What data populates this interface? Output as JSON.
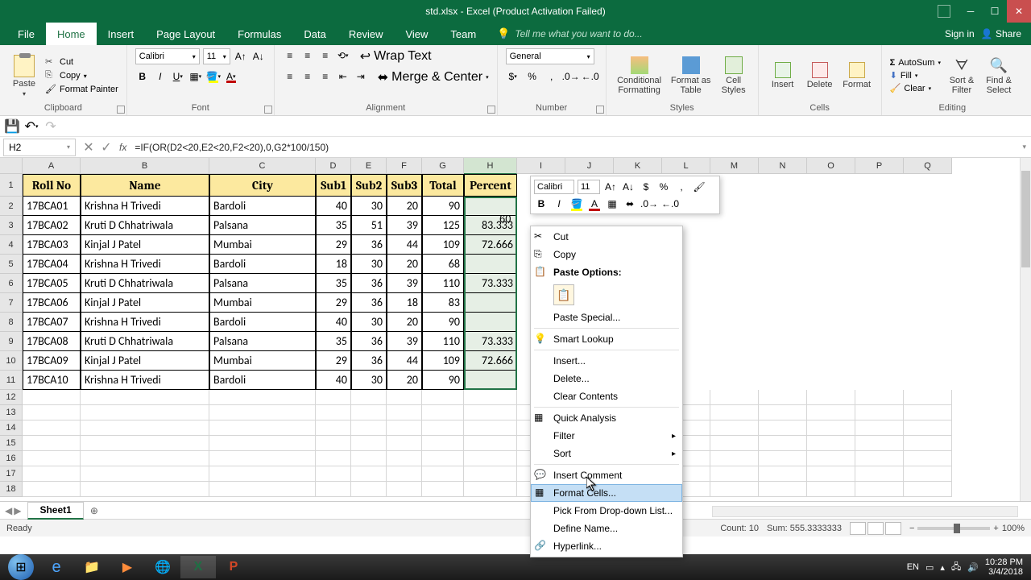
{
  "title": "std.xlsx - Excel (Product Activation Failed)",
  "ribbon": {
    "tabs": [
      "File",
      "Home",
      "Insert",
      "Page Layout",
      "Formulas",
      "Data",
      "Review",
      "View",
      "Team"
    ],
    "active": 1,
    "tellme": "Tell me what you want to do...",
    "signin": "Sign in",
    "share": "Share"
  },
  "clipboard": {
    "cut": "Cut",
    "copy": "Copy",
    "painter": "Format Painter",
    "paste": "Paste",
    "label": "Clipboard"
  },
  "font": {
    "name": "Calibri",
    "size": "11",
    "label": "Font"
  },
  "alignment": {
    "wrap": "Wrap Text",
    "merge": "Merge & Center",
    "label": "Alignment"
  },
  "number": {
    "format": "General",
    "label": "Number"
  },
  "styles": {
    "cond": "Conditional Formatting",
    "table": "Format as Table",
    "cell": "Cell Styles",
    "label": "Styles"
  },
  "cells": {
    "insert": "Insert",
    "delete": "Delete",
    "format": "Format",
    "label": "Cells"
  },
  "editing": {
    "sum": "AutoSum",
    "fill": "Fill",
    "clear": "Clear",
    "sort": "Sort & Filter",
    "find": "Find & Select",
    "label": "Editing"
  },
  "namebox": "H2",
  "formula": "=IF(OR(D2<20,E2<20,F2<20),0,G2*100/150)",
  "columns": [
    "A",
    "B",
    "C",
    "D",
    "E",
    "F",
    "G",
    "H",
    "I",
    "J",
    "K",
    "L",
    "M",
    "N",
    "O",
    "P",
    "Q"
  ],
  "headers": [
    "Roll No",
    "Name",
    "City",
    "Sub1",
    "Sub2",
    "Sub3",
    "Total",
    "Percent"
  ],
  "rows": [
    {
      "r": "17BCA01",
      "n": "Krishna H Trivedi",
      "c": "Bardoli",
      "s1": 40,
      "s2": 30,
      "s3": 20,
      "t": 90,
      "p": ""
    },
    {
      "r": "17BCA02",
      "n": "Kruti D Chhatriwala",
      "c": "Palsana",
      "s1": 35,
      "s2": 51,
      "s3": 39,
      "t": 125,
      "p": "83.333"
    },
    {
      "r": "17BCA03",
      "n": "Kinjal J Patel",
      "c": "Mumbai",
      "s1": 29,
      "s2": 36,
      "s3": 44,
      "t": 109,
      "p": "72.666"
    },
    {
      "r": "17BCA04",
      "n": "Krishna H Trivedi",
      "c": "Bardoli",
      "s1": 18,
      "s2": 30,
      "s3": 20,
      "t": 68,
      "p": ""
    },
    {
      "r": "17BCA05",
      "n": "Kruti D Chhatriwala",
      "c": "Palsana",
      "s1": 35,
      "s2": 36,
      "s3": 39,
      "t": 110,
      "p": "73.333"
    },
    {
      "r": "17BCA06",
      "n": "Kinjal J Patel",
      "c": "Mumbai",
      "s1": 29,
      "s2": 36,
      "s3": 18,
      "t": 83,
      "p": ""
    },
    {
      "r": "17BCA07",
      "n": "Krishna H Trivedi",
      "c": "Bardoli",
      "s1": 40,
      "s2": 30,
      "s3": 20,
      "t": 90,
      "p": ""
    },
    {
      "r": "17BCA08",
      "n": "Kruti D Chhatriwala",
      "c": "Palsana",
      "s1": 35,
      "s2": 36,
      "s3": 39,
      "t": 110,
      "p": "73.333"
    },
    {
      "r": "17BCA09",
      "n": "Kinjal J Patel",
      "c": "Mumbai",
      "s1": 29,
      "s2": 36,
      "s3": 44,
      "t": 109,
      "p": "72.666"
    },
    {
      "r": "17BCA10",
      "n": "Krishna H Trivedi",
      "c": "Bardoli",
      "s1": 40,
      "s2": 30,
      "s3": 20,
      "t": 90,
      "p": ""
    }
  ],
  "minitoolbar": {
    "font": "Calibri",
    "size": "11"
  },
  "h2_display": "60",
  "contextmenu": {
    "cut": "Cut",
    "copy": "Copy",
    "pasteoptions": "Paste Options:",
    "pastespecial": "Paste Special...",
    "smartlookup": "Smart Lookup",
    "insert": "Insert...",
    "delete": "Delete...",
    "clear": "Clear Contents",
    "quick": "Quick Analysis",
    "filter": "Filter",
    "sort": "Sort",
    "comment": "Insert Comment",
    "formatcells": "Format Cells...",
    "pick": "Pick From Drop-down List...",
    "define": "Define Name...",
    "hyperlink": "Hyperlink..."
  },
  "sheet": {
    "name": "Sheet1"
  },
  "status": {
    "ready": "Ready",
    "count": "Count: 10",
    "sum": "Sum: 555.3333333",
    "avg_hint": "",
    "zoom": "100%"
  },
  "tray": {
    "lang": "EN",
    "time": "10:28 PM",
    "date": "3/4/2018"
  }
}
